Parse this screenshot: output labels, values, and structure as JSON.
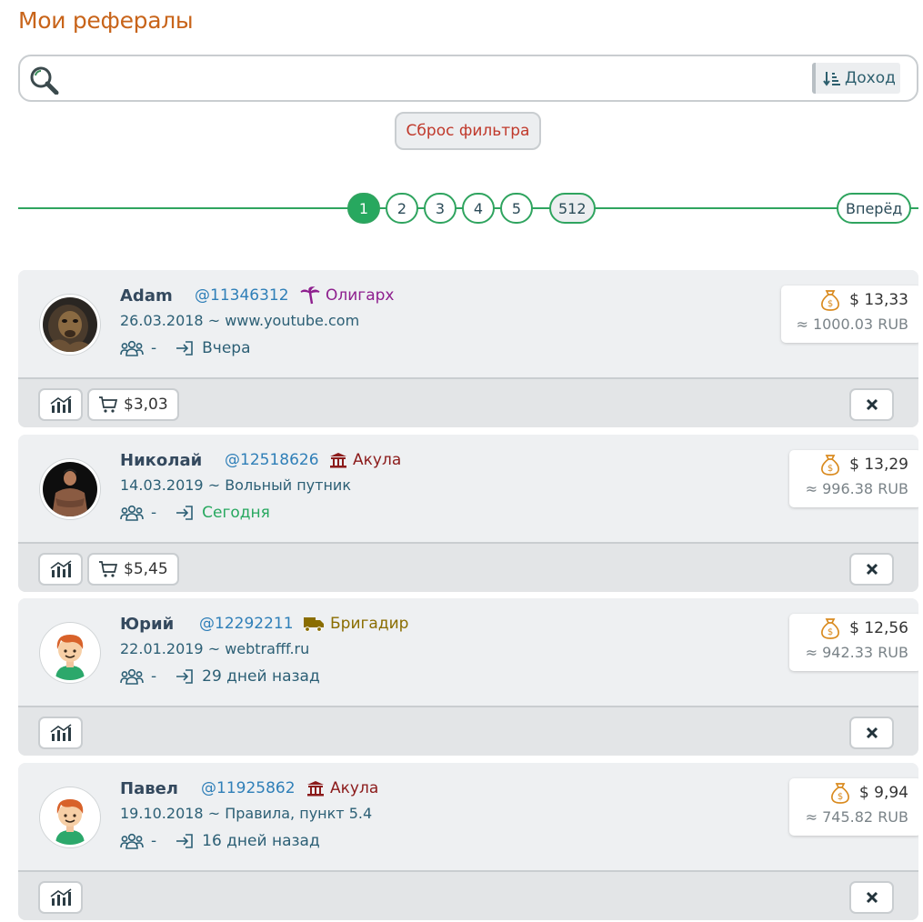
{
  "page": {
    "title": "Мои рефералы"
  },
  "search": {
    "placeholder": "",
    "value": "",
    "sort_label": "Доход"
  },
  "filters": {
    "reset_label": "Сброс фильтра"
  },
  "pagination": {
    "pages": [
      "1",
      "2",
      "3",
      "4",
      "5"
    ],
    "last_page": "512",
    "current": "1",
    "next_label": "Вперёд"
  },
  "colors": {
    "accent": "#27a85f",
    "title": "#c8641a",
    "reset": "#c0392b",
    "id_link": "#2f7fb8"
  },
  "referrals": [
    {
      "name": "Adam",
      "id": "@11346312",
      "rank": {
        "label": "Олигарх",
        "icon": "palm-icon",
        "color": "#8e1f8e"
      },
      "reg_date": "26.03.2018",
      "source": "www.youtube.com",
      "team": "-",
      "last_login": "Вчера",
      "login_color": "#2c5f75",
      "income_usd": "$ 13,33",
      "income_rub": "≈ 1000.03 RUB",
      "cart": "$3,03",
      "avatar": "photo-lion"
    },
    {
      "name": "Николай",
      "id": "@12518626",
      "rank": {
        "label": "Акула",
        "icon": "bank-icon",
        "color": "#8b1a1a"
      },
      "reg_date": "14.03.2019",
      "source": "Вольный путник",
      "team": "-",
      "last_login": "Сегодня",
      "login_color": "#27a85f",
      "income_usd": "$ 13,29",
      "income_rub": "≈ 996.38 RUB",
      "cart": "$5,45",
      "avatar": "photo-man"
    },
    {
      "name": "Юрий",
      "id": "@12292211",
      "rank": {
        "label": "Бригадир",
        "icon": "truck-icon",
        "color": "#8a6d00"
      },
      "reg_date": "22.01.2019",
      "source": "webtrafff.ru",
      "team": "-",
      "last_login": "29 дней назад",
      "login_color": "#2c5f75",
      "income_usd": "$ 12,56",
      "income_rub": "≈ 942.33 RUB",
      "cart": null,
      "avatar": "cartoon-boy"
    },
    {
      "name": "Павел",
      "id": "@11925862",
      "rank": {
        "label": "Акула",
        "icon": "bank-icon",
        "color": "#8b1a1a"
      },
      "reg_date": "19.10.2018",
      "source": "Правила, пункт 5.4",
      "team": "-",
      "last_login": "16 дней назад",
      "login_color": "#2c5f75",
      "income_usd": "$ 9,94",
      "income_rub": "≈ 745.82 RUB",
      "cart": null,
      "avatar": "cartoon-boy"
    }
  ]
}
